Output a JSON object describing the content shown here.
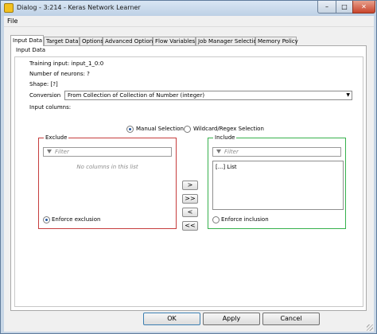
{
  "window": {
    "title": "Dialog - 3:214 - Keras Network Learner"
  },
  "menu": {
    "file": "File"
  },
  "tabs": [
    {
      "label": "Input Data",
      "active": true
    },
    {
      "label": "Target Data"
    },
    {
      "label": "Options"
    },
    {
      "label": "Advanced Options"
    },
    {
      "label": "Flow Variables"
    },
    {
      "label": "Job Manager Selection"
    },
    {
      "label": "Memory Policy"
    }
  ],
  "input_data": {
    "group_title": "Input Data",
    "training_input": "Training input: input_1_0:0",
    "num_neurons": "Number of neurons: ?",
    "shape": "Shape: [?]",
    "conversion_label": "Conversion",
    "conversion_value": "From Collection of Collection of Number (integer)",
    "input_columns_label": "Input columns:",
    "mode_manual": "Manual Selection",
    "mode_wildcard": "Wildcard/Regex Selection",
    "exclude": {
      "title": "Exclude",
      "filter_placeholder": "Filter",
      "empty_text": "No columns in this list",
      "enforce_label": "Enforce exclusion"
    },
    "include": {
      "title": "Include",
      "filter_placeholder": "Filter",
      "items": [
        "[...] List"
      ],
      "enforce_label": "Enforce inclusion"
    },
    "move_buttons": [
      ">",
      ">>",
      "<",
      "<<"
    ]
  },
  "buttons": {
    "ok": "OK",
    "apply": "Apply",
    "cancel": "Cancel"
  }
}
